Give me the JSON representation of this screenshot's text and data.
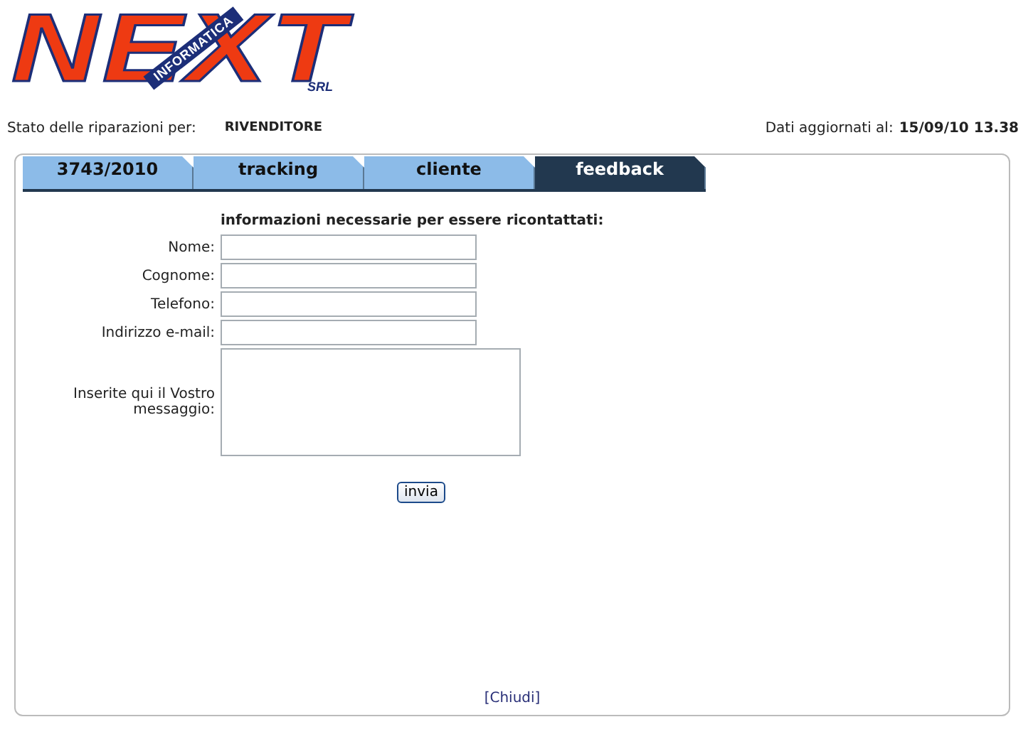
{
  "logo": {
    "word": "NEXT",
    "banner": "INFORMATICA",
    "suffix": "SRL"
  },
  "status": {
    "label": "Stato delle riparazioni per:",
    "value": "RIVENDITORE",
    "updated_label": "Dati aggiornati al:",
    "updated_value": "15/09/10 13.38"
  },
  "tabs": [
    {
      "label": "3743/2010",
      "selected": false
    },
    {
      "label": "tracking",
      "selected": false
    },
    {
      "label": "cliente",
      "selected": false
    },
    {
      "label": "feedback",
      "selected": true
    }
  ],
  "form": {
    "heading": "informazioni necessarie per essere ricontattati:",
    "fields": [
      {
        "label": "Nome:",
        "kind": "text"
      },
      {
        "label": "Cognome:",
        "kind": "text"
      },
      {
        "label": "Telefono:",
        "kind": "text"
      },
      {
        "label": "Indirizzo e-mail:",
        "kind": "text"
      },
      {
        "label": "Inserite qui il Vostro messaggio:",
        "kind": "textarea"
      }
    ],
    "submit": "invia"
  },
  "close_link": "[Chiudi]"
}
